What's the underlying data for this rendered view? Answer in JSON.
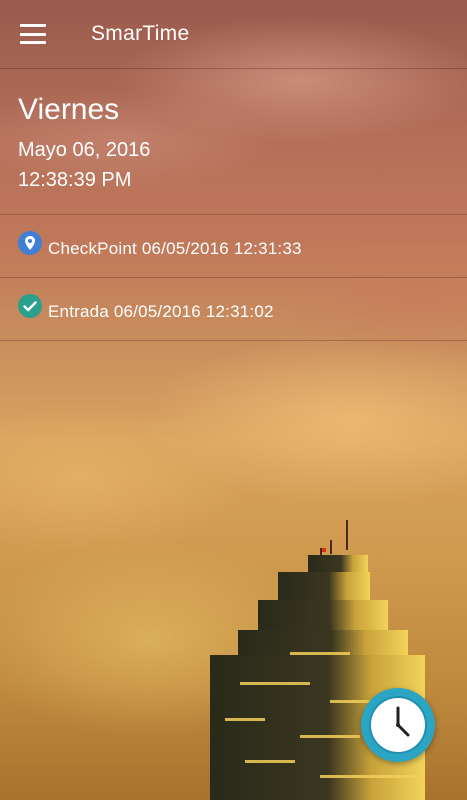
{
  "app_bar": {
    "title": "SmarTime",
    "menu_icon": "hamburger-menu-icon"
  },
  "current": {
    "day_name": "Viernes",
    "date": "Mayo 06, 2016",
    "time": "12:38:39 PM"
  },
  "log_entries": [
    {
      "icon": "location-pin-icon",
      "icon_color": "#3f7fd6",
      "text": "CheckPoint 06/05/2016 12:31:33"
    },
    {
      "icon": "checkmark-icon",
      "icon_color": "#2aa08f",
      "text": "Entrada 06/05/2016 12:31:02"
    }
  ],
  "fab": {
    "icon": "clock-icon",
    "color": "#2aa6c4"
  }
}
